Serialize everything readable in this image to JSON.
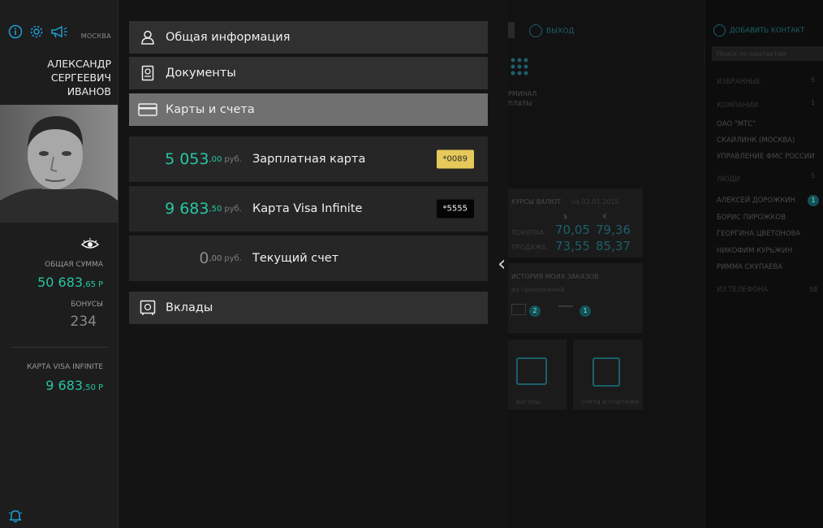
{
  "profile": {
    "city": "МОСКВА",
    "name_lines": [
      "АЛЕКСАНДР",
      "СЕРГЕЕВИЧ",
      "ИВАНОВ"
    ],
    "total_label": "ОБЩАЯ СУММА",
    "total_int": "50 683",
    "total_dec": ",65",
    "total_cur": "Р",
    "bonus_label": "БОНУСЫ",
    "bonus_value": "234",
    "card_label": "КАРТА VISA INFINITE",
    "card_int": "9 683",
    "card_dec": ",50",
    "card_cur": "Р"
  },
  "menu": {
    "items": [
      {
        "label": "Общая информация",
        "icon": "person-icon"
      },
      {
        "label": "Документы",
        "icon": "passport-icon"
      },
      {
        "label": "Карты и счета",
        "icon": "card-icon",
        "active": true
      }
    ],
    "deposits_label": "Вклады"
  },
  "accounts": [
    {
      "int": "5 053",
      "dec": ",00",
      "cur": "руб.",
      "name": "Зарплатная карта",
      "tag": "*0089"
    },
    {
      "int": "9 683",
      "dec": ",50",
      "cur": "руб.",
      "name": "Карта Visa Infinite",
      "tag": "*5555"
    },
    {
      "int": "0",
      "dec": ",00",
      "cur": "руб.",
      "name": "Текущий счет",
      "tag": ""
    }
  ],
  "background": {
    "exit_label": "ВЫХОД",
    "add_contact_label": "ДОБАВИТЬ КОНТАКТ",
    "search_placeholder": "Поиск по контактам",
    "terminal_label": "РМИНАЛ\nПЛАТЫ",
    "rates_title": "КУРСЫ ВАЛЮТ",
    "rates_date": "на 02.01.2015",
    "usd_sign": "$",
    "eur_sign": "€",
    "buy_label": "ПОКУПКА",
    "sell_label": "ПРОДАЖА",
    "usd_buy": "70,05",
    "usd_sell": "73,55",
    "eur_buy": "79,36",
    "eur_sell": "85,37",
    "orders_title": "ИСТОРИЯ МОИХ ЗАКАЗОВ",
    "orders_sub": "из приложений",
    "badge1": "2",
    "badge2": "1",
    "tile1": "вагоны",
    "tile2": "счета и платежи",
    "contacts": [
      "ИЗБРАННЫЕ",
      "КОМПАНИИ",
      "ОАО \"МТС\"",
      "СКАЙЛИНК (МОСКВА)",
      "УПРАВЛЕНИЕ ФМС РОССИИ",
      "ЛЮДИ",
      "АЛЕКСЕЙ ДОРОЖКИН",
      "БОРИС ПИРОЖКОВ",
      "ГЕОРГИНА ЦВЕТОНОВА",
      "НИКОФИМ КУРЬЖИН",
      "РИММА СКУПАЕВА",
      "ИЗ ТЕЛЕФОНА"
    ],
    "counts": [
      "5",
      "1",
      "5",
      "58"
    ]
  },
  "colors": {
    "accent": "#26c6a2",
    "gold_tag": "#e6c95a"
  }
}
